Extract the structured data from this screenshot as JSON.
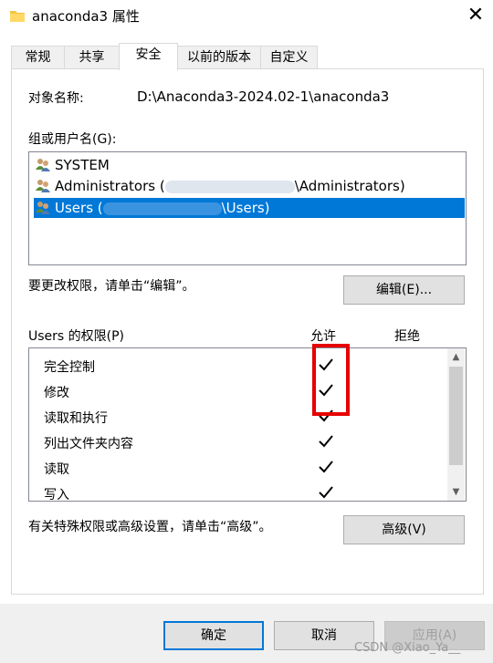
{
  "window": {
    "title": "anaconda3 属性"
  },
  "tabs": [
    {
      "label": "常规"
    },
    {
      "label": "共享"
    },
    {
      "label": "安全"
    },
    {
      "label": "以前的版本"
    },
    {
      "label": "自定义"
    }
  ],
  "security": {
    "object_name_label": "对象名称:",
    "object_name_value": "D:\\Anaconda3-2024.02-1\\anaconda3",
    "group_label": "组或用户名(G):",
    "users": [
      {
        "prefix": "SYSTEM",
        "suffix": ""
      },
      {
        "prefix": "Administrators (",
        "suffix": "\\Administrators)"
      },
      {
        "prefix": "Users (",
        "suffix": "\\Users)"
      }
    ],
    "edit_hint": "要更改权限，请单击“编辑”。",
    "edit_button": "编辑(E)...",
    "perm_label": "Users 的权限(P)",
    "allow_header": "允许",
    "deny_header": "拒绝",
    "permissions": [
      {
        "name": "完全控制",
        "allow": true,
        "deny": false
      },
      {
        "name": "修改",
        "allow": true,
        "deny": false
      },
      {
        "name": "读取和执行",
        "allow": true,
        "deny": false
      },
      {
        "name": "列出文件夹内容",
        "allow": true,
        "deny": false
      },
      {
        "name": "读取",
        "allow": true,
        "deny": false
      },
      {
        "name": "写入",
        "allow": true,
        "deny": false
      }
    ],
    "advanced_hint": "有关特殊权限或高级设置，请单击“高级”。",
    "advanced_button": "高级(V)"
  },
  "footer": {
    "ok": "确定",
    "cancel": "取消",
    "apply": "应用(A)"
  },
  "watermark": "CSDN @Xiao_Ya__",
  "colors": {
    "selection": "#0078d7",
    "highlight": "#e60000"
  }
}
